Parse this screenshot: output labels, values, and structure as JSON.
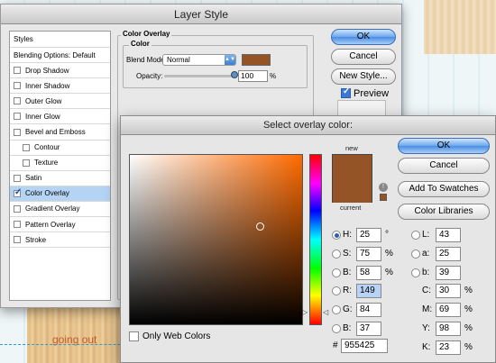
{
  "background": {
    "canvas_text": "going out"
  },
  "layer_style": {
    "title": "Layer Style",
    "styles_header": "Styles",
    "items": [
      {
        "label": "Blending Options: Default",
        "checkbox": false,
        "checked": false,
        "sub": false,
        "selected": false
      },
      {
        "label": "Drop Shadow",
        "checkbox": true,
        "checked": false,
        "sub": false,
        "selected": false
      },
      {
        "label": "Inner Shadow",
        "checkbox": true,
        "checked": false,
        "sub": false,
        "selected": false
      },
      {
        "label": "Outer Glow",
        "checkbox": true,
        "checked": false,
        "sub": false,
        "selected": false
      },
      {
        "label": "Inner Glow",
        "checkbox": true,
        "checked": false,
        "sub": false,
        "selected": false
      },
      {
        "label": "Bevel and Emboss",
        "checkbox": true,
        "checked": false,
        "sub": false,
        "selected": false
      },
      {
        "label": "Contour",
        "checkbox": true,
        "checked": false,
        "sub": true,
        "selected": false
      },
      {
        "label": "Texture",
        "checkbox": true,
        "checked": false,
        "sub": true,
        "selected": false
      },
      {
        "label": "Satin",
        "checkbox": true,
        "checked": false,
        "sub": false,
        "selected": false
      },
      {
        "label": "Color Overlay",
        "checkbox": true,
        "checked": true,
        "sub": false,
        "selected": true
      },
      {
        "label": "Gradient Overlay",
        "checkbox": true,
        "checked": false,
        "sub": false,
        "selected": false
      },
      {
        "label": "Pattern Overlay",
        "checkbox": true,
        "checked": false,
        "sub": false,
        "selected": false
      },
      {
        "label": "Stroke",
        "checkbox": true,
        "checked": false,
        "sub": false,
        "selected": false
      }
    ],
    "panel_title": "Color Overlay",
    "group_title": "Color",
    "blend_mode_label": "Blend Mode:",
    "blend_mode_value": "Normal",
    "opacity_label": "Opacity:",
    "opacity_value": "100",
    "opacity_unit": "%",
    "overlay_color": "#955425",
    "ok_label": "OK",
    "cancel_label": "Cancel",
    "new_style_label": "New Style...",
    "preview_label": "Preview",
    "preview_checked": true
  },
  "color_picker": {
    "title": "Select overlay color:",
    "new_label": "new",
    "current_label": "current",
    "new_color": "#955425",
    "current_color": "#955425",
    "ok_label": "OK",
    "cancel_label": "Cancel",
    "add_swatches_label": "Add To Swatches",
    "color_libraries_label": "Color Libraries",
    "only_web_label": "Only Web Colors",
    "only_web_checked": false,
    "hsb": [
      {
        "label": "H:",
        "value": "25",
        "unit": "°",
        "selected": true
      },
      {
        "label": "S:",
        "value": "75",
        "unit": "%",
        "selected": false
      },
      {
        "label": "B:",
        "value": "58",
        "unit": "%",
        "selected": false
      }
    ],
    "rgb": [
      {
        "label": "R:",
        "value": "149",
        "selected": false,
        "highlight": true
      },
      {
        "label": "G:",
        "value": "84",
        "selected": false,
        "highlight": false
      },
      {
        "label": "B:",
        "value": "37",
        "selected": false,
        "highlight": false
      }
    ],
    "lab": [
      {
        "label": "L:",
        "value": "43"
      },
      {
        "label": "a:",
        "value": "25"
      },
      {
        "label": "b:",
        "value": "39"
      }
    ],
    "cmyk": [
      {
        "label": "C:",
        "value": "30",
        "unit": "%"
      },
      {
        "label": "M:",
        "value": "69",
        "unit": "%"
      },
      {
        "label": "Y:",
        "value": "98",
        "unit": "%"
      },
      {
        "label": "K:",
        "value": "23",
        "unit": "%"
      }
    ],
    "hex_label": "#",
    "hex_value": "955425",
    "hue_degrees": 25,
    "saturation_fraction": 0.75,
    "brightness_fraction": 0.58
  }
}
